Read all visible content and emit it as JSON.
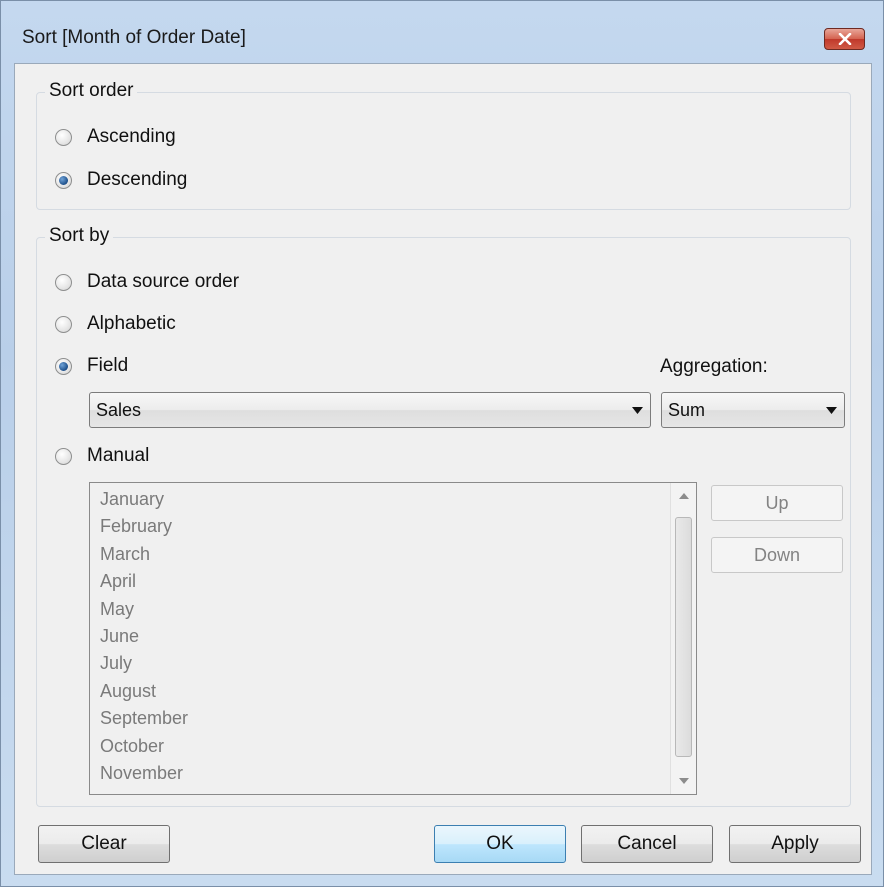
{
  "window": {
    "title": "Sort [Month of Order Date]"
  },
  "sort_order": {
    "legend": "Sort order",
    "options": [
      {
        "label": "Ascending",
        "checked": false
      },
      {
        "label": "Descending",
        "checked": true
      }
    ]
  },
  "sort_by": {
    "legend": "Sort by",
    "options": [
      {
        "label": "Data source order",
        "checked": false
      },
      {
        "label": "Alphabetic",
        "checked": false
      },
      {
        "label": "Field",
        "checked": true
      },
      {
        "label": "Manual",
        "checked": false
      }
    ],
    "field_value": "Sales",
    "aggregation_label": "Aggregation:",
    "aggregation_value": "Sum",
    "manual_list": [
      "January",
      "February",
      "March",
      "April",
      "May",
      "June",
      "July",
      "August",
      "September",
      "October",
      "November"
    ],
    "up_label": "Up",
    "down_label": "Down"
  },
  "buttons": {
    "clear": "Clear",
    "ok": "OK",
    "cancel": "Cancel",
    "apply": "Apply"
  },
  "icons": {
    "close": "close-icon",
    "dropdown": "chevron-down-icon",
    "scroll_up": "scroll-up-arrow-icon",
    "scroll_down": "scroll-down-arrow-icon"
  }
}
